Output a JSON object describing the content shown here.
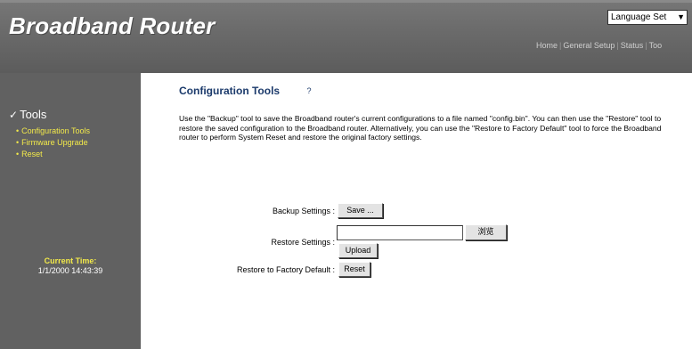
{
  "header": {
    "brand": "Broadband Router",
    "language_select": "Language Set",
    "nav": [
      "Home",
      "General Setup",
      "Status",
      "Too"
    ]
  },
  "sidebar": {
    "section_title": "Tools",
    "items": [
      {
        "label": "Configuration Tools",
        "active": true
      },
      {
        "label": "Firmware Upgrade",
        "active": false
      },
      {
        "label": "Reset",
        "active": false
      }
    ],
    "current_time_label": "Current Time:",
    "current_time_value": "1/1/2000 14:43:39"
  },
  "main": {
    "title": "Configuration Tools",
    "description": "Use the \"Backup\" tool to save the Broadband router's current configurations to a file named \"config.bin\". You can then use the \"Restore\" tool to restore the saved configuration to the Broadband router. Alternatively, you can use the \"Restore to Factory Default\" tool to force the Broadband router to perform System Reset and restore the original factory settings.",
    "backup": {
      "label": "Backup Settings :",
      "button": "Save ..."
    },
    "restore": {
      "label": "Restore Settings :",
      "browse_button": "浏览",
      "upload_button": "Upload",
      "file_value": ""
    },
    "factory": {
      "label": "Restore to Factory Default :",
      "button": "Reset"
    }
  },
  "colors": {
    "header_bg": "#6a6a6a",
    "sidebar_bg": "#616161",
    "link": "#f2e94a",
    "title": "#1b3a6b"
  }
}
